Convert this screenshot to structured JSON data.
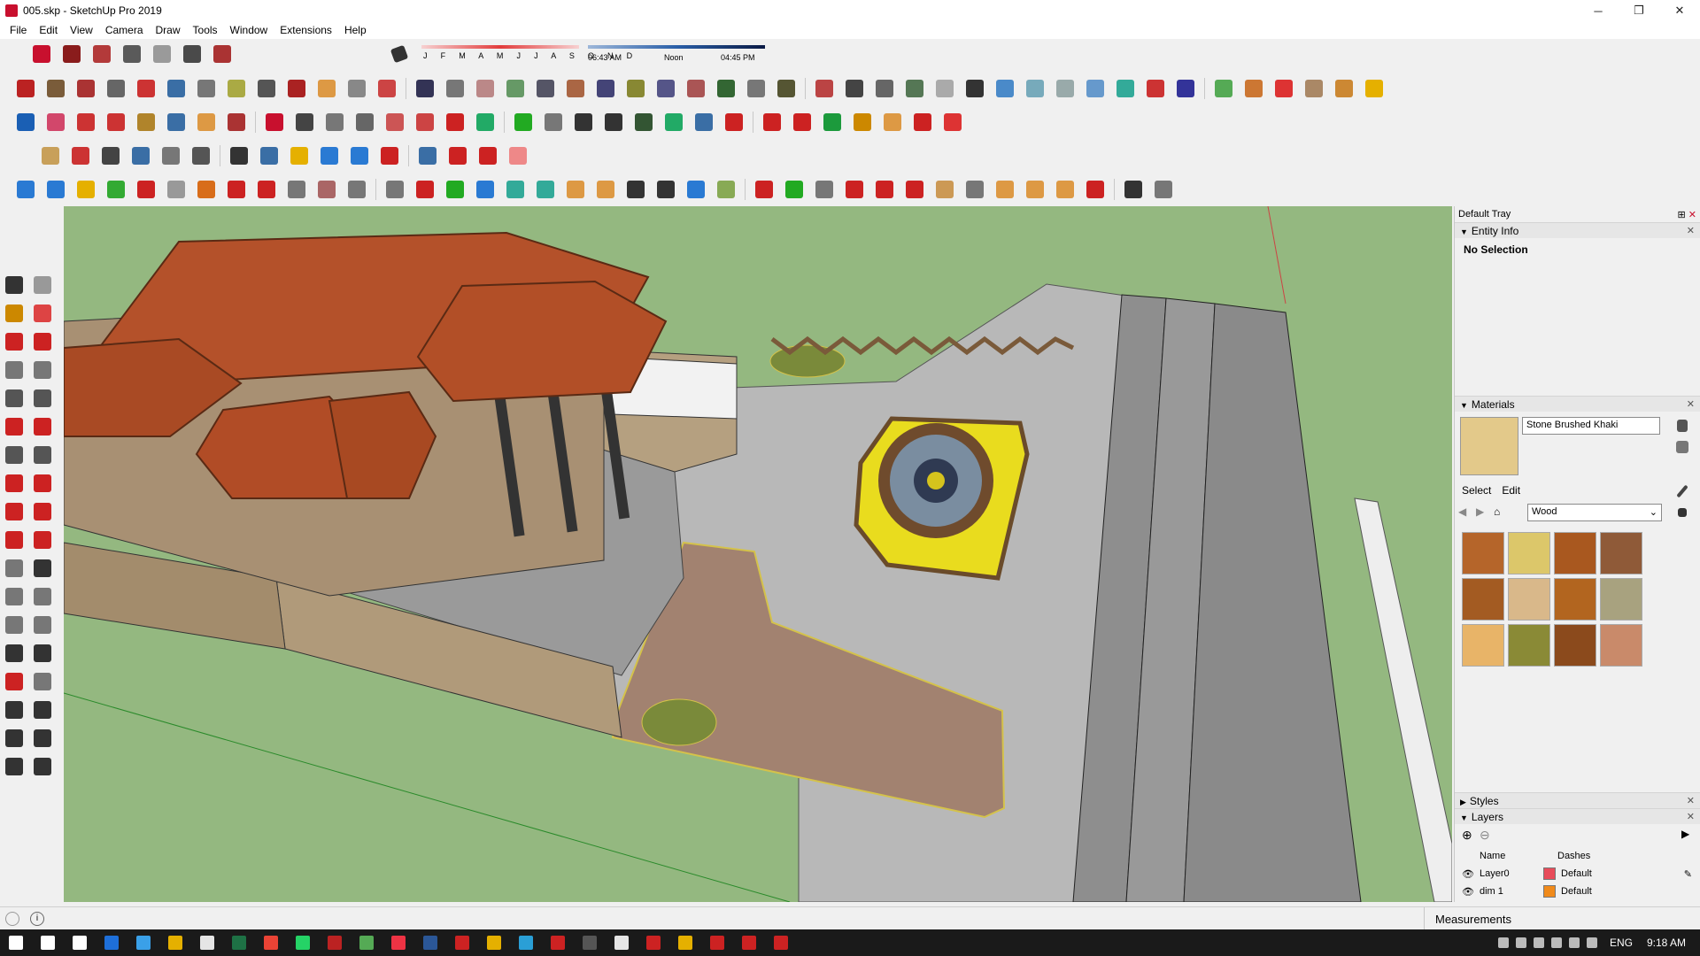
{
  "window": {
    "title": "005.skp - SketchUp Pro 2019",
    "minimize_glyph": "─",
    "restore_glyph": "❐",
    "close_glyph": "✕"
  },
  "menu": [
    "File",
    "Edit",
    "View",
    "Camera",
    "Draw",
    "Tools",
    "Window",
    "Extensions",
    "Help"
  ],
  "shadow_settings": {
    "months": "J F M A M J J A S O N D",
    "time_start": "06:43 AM",
    "time_mid": "Noon",
    "time_end": "04:45 PM"
  },
  "toolbar_colors": {
    "row1": [
      "#c8102e",
      "#8a1c1c",
      "#b33a3a",
      "#5a5a5a",
      "#9a9a9a",
      "#4a4a4a",
      "#a33"
    ],
    "row2": [
      "#b22",
      "#7a5c3a",
      "#a33",
      "#666",
      "#c33",
      "#3a6ea5",
      "#777",
      "#aa4",
      "#555",
      "#a22",
      "#d94",
      "#888",
      "#c44",
      "#335",
      "#777",
      "#b88",
      "#696",
      "#556",
      "#a64",
      "#447",
      "#883",
      "#558",
      "#a55",
      "#363",
      "#777",
      "#553",
      "#b44",
      "#444",
      "#666",
      "#575",
      "#aaa",
      "#333",
      "#4a8ac9",
      "#7ab",
      "#9aa",
      "#69c",
      "#3a9",
      "#c33",
      "#339",
      "#5a5",
      "#c73",
      "#d33",
      "#a86",
      "#c83",
      "#e5b000"
    ],
    "row3": [
      "#1a5fb4",
      "#d2476b",
      "#c33",
      "#c33",
      "#b0842b",
      "#3a6ea5",
      "#d94",
      "#a33",
      "#c8102e",
      "#444",
      "#777",
      "#666",
      "#c55",
      "#c44",
      "#c22",
      "#2a6",
      "#2a2",
      "#777",
      "#333",
      "#333",
      "#353",
      "#2a6",
      "#3a6ea5",
      "#c22",
      "#c22",
      "#c22",
      "#1c9a3c",
      "#c80",
      "#d94",
      "#c22",
      "#d33"
    ],
    "row4": [
      "#c8a05a",
      "#c33",
      "#444",
      "#3a6ea5",
      "#777",
      "#555",
      "#333",
      "#3a6ea5",
      "#e5b000",
      "#2a7ad3",
      "#2a7ad3",
      "#c22",
      "#3a6ea5",
      "#c22",
      "#c22",
      "#e88"
    ],
    "row5": [
      "#2a7ad3",
      "#2a7ad3",
      "#e5b000",
      "#3a3",
      "#c22",
      "#999",
      "#d86d1a",
      "#c22",
      "#c22",
      "#777",
      "#a66",
      "#777",
      "#777",
      "#c22",
      "#2a2",
      "#2a7ad3",
      "#3a9",
      "#3a9",
      "#d94",
      "#d94",
      "#333",
      "#333",
      "#2a7ad3",
      "#8a5",
      "#c22",
      "#2a2",
      "#777",
      "#c22",
      "#c22",
      "#c22",
      "#c95",
      "#777",
      "#d94",
      "#d94",
      "#d94",
      "#c22",
      "#333",
      "#777"
    ]
  },
  "left_toolbar_colors": [
    "#333",
    "#999",
    "#c80",
    "#d44",
    "#c22",
    "#c22",
    "#777",
    "#777",
    "#555",
    "#555",
    "#c22",
    "#c22",
    "#555",
    "#555",
    "#c22",
    "#c22",
    "#c22",
    "#c22",
    "#c22",
    "#c22",
    "#777",
    "#333",
    "#777",
    "#777",
    "#777",
    "#777",
    "#333",
    "#333",
    "#c22",
    "#777",
    "#333",
    "#333",
    "#333",
    "#333",
    "#333",
    "#333"
  ],
  "tray": {
    "title": "Default Tray",
    "pin_glyph": "⊞",
    "close_glyph": "✕",
    "entity_info": {
      "title": "Entity Info",
      "selection": "No Selection"
    },
    "materials": {
      "title": "Materials",
      "name": "Stone Brushed Khaki",
      "tabs": [
        "Select",
        "Edit"
      ],
      "library": "Wood",
      "swatch_colors": [
        "#b5652a",
        "#dcc76a",
        "#a9581f",
        "#8f5a38",
        "#a35b22",
        "#d9b88a",
        "#b2651f",
        "#a8a27f",
        "#e8b468",
        "#8a8a36",
        "#8b4a1c",
        "#c98a6a"
      ]
    },
    "styles": {
      "title": "Styles"
    },
    "layers": {
      "title": "Layers",
      "columns": [
        "Name",
        "Dashes"
      ],
      "rows": [
        {
          "name": "Layer0",
          "dashes": "Default",
          "color": "#e84c5a"
        },
        {
          "name": "dim 1",
          "dashes": "Default",
          "color": "#f08a1a"
        }
      ]
    }
  },
  "status": {
    "measurements_label": "Measurements",
    "info_glyph": "i"
  },
  "taskbar": {
    "app_colors": [
      "#fff",
      "#fff",
      "#fff",
      "#1e6fd9",
      "#3aa0e8",
      "#e5b000",
      "#e5e5e5",
      "#1e7145",
      "#ea4335",
      "#25d366",
      "#b22",
      "#5a5",
      "#e34",
      "#2b5797",
      "#c22",
      "#e5b000",
      "#2a9fd6",
      "#c22",
      "#555",
      "#e5e5e5",
      "#c22",
      "#e5b000",
      "#c22",
      "#c22",
      "#c22"
    ],
    "language": "ENG",
    "time": "9:18 AM"
  }
}
